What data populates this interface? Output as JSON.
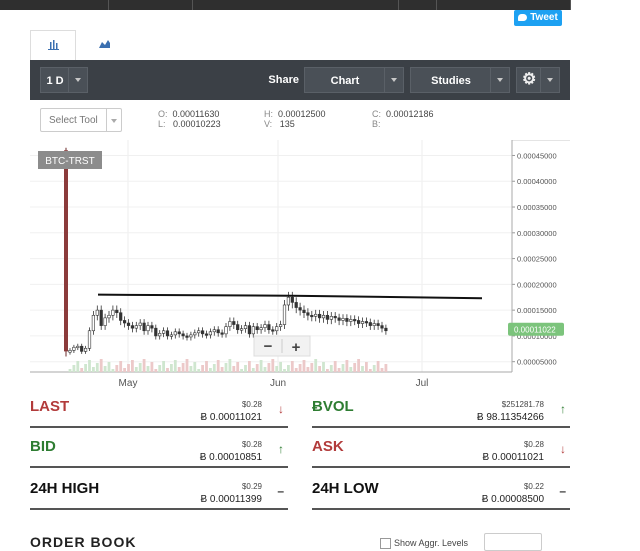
{
  "header": {
    "tweet_label": "Tweet"
  },
  "toolbar": {
    "interval": "1 D",
    "share_label": "Share",
    "chart_label": "Chart",
    "studies_label": "Studies"
  },
  "infobar": {
    "select_tool": "Select Tool",
    "o_label": "O:",
    "o_value": "0.00011630",
    "l_label": "L:",
    "l_value": "0.00010223",
    "h_label": "H:",
    "h_value": "0.00012500",
    "v_label": "V:",
    "v_value": "135",
    "c_label": "C:",
    "c_value": "0.00012186",
    "b_label": "B:"
  },
  "chart_data": {
    "type": "candlestick",
    "symbol": "BTC-TRST",
    "x_tick_labels": [
      "May",
      "Jun",
      "Jul"
    ],
    "y_tick_labels": [
      "0.00045000",
      "0.00040000",
      "0.00035000",
      "0.00030000",
      "0.00025000",
      "0.00020000",
      "0.00015000",
      "0.00010000",
      "0.00005000"
    ],
    "ylim": [
      3e-05,
      0.00048
    ],
    "last_price_label": "0.00011022",
    "trend_line": [
      [
        0.00018,
        0.00018
      ],
      [
        0.00018,
        0.000175
      ]
    ],
    "close_series": [
      7.2e-05,
      7.8e-05,
      8e-05,
      7e-05,
      7.6e-05,
      0.00011,
      0.00014,
      0.00015,
      0.00012,
      0.000135,
      0.00014,
      0.00015,
      0.000145,
      0.00013,
      0.000125,
      0.00012,
      0.000115,
      0.00012,
      0.000125,
      0.00011,
      0.00012,
      0.000115,
      0.0001,
      0.000105,
      0.00011,
      0.0001,
      0.000102,
      0.000108,
      0.000104,
      0.0001,
      9.8e-05,
      0.000102,
      0.000106,
      0.00011,
      0.000104,
      0.000102,
      0.000108,
      0.000112,
      0.000106,
      0.000104,
      0.000118,
      0.000128,
      0.000122,
      0.000112,
      0.000114,
      0.00012,
      0.000104,
      0.000118,
      0.000112,
      0.000116,
      0.000122,
      0.000112,
      0.00011,
      0.000118,
      0.000122,
      0.00016,
      0.000175,
      0.000165,
      0.000155,
      0.00015,
      0.000145,
      0.00014,
      0.000138,
      0.000142,
      0.000135,
      0.00014,
      0.000132,
      0.000138,
      0.000135,
      0.00013,
      0.000134,
      0.000128,
      0.000132,
      0.00013,
      0.000124,
      0.000128,
      0.000126,
      0.00012,
      0.000124,
      0.00012,
      0.000115,
      0.00011
    ]
  },
  "zoom": {
    "minus": "−",
    "plus": "+"
  },
  "stats": {
    "last": {
      "name": "LAST",
      "usd": "$0.28",
      "btc": "Ƀ 0.00011021",
      "arrow": "↓"
    },
    "vol": {
      "name": "ɃVOL",
      "usd": "$251281.78",
      "btc": "Ƀ 98.11354266",
      "arrow": "↑"
    },
    "bid": {
      "name": "BID",
      "usd": "$0.28",
      "btc": "Ƀ 0.00010851",
      "arrow": "↑"
    },
    "ask": {
      "name": "ASK",
      "usd": "$0.28",
      "btc": "Ƀ 0.00011021",
      "arrow": "↓"
    },
    "high": {
      "name": "24H HIGH",
      "usd": "$0.29",
      "btc": "Ƀ 0.00011399",
      "arrow": "–"
    },
    "low": {
      "name": "24H LOW",
      "usd": "$0.22",
      "btc": "Ƀ 0.00008500",
      "arrow": "–"
    }
  },
  "orderbook": {
    "title": "ORDER BOOK",
    "option_label": "Show Aggr. Levels"
  },
  "colors": {
    "up": "#2e7d32",
    "down": "#b23b3b",
    "price_tag": "#7cc47c",
    "toolbar": "#3b4046"
  }
}
